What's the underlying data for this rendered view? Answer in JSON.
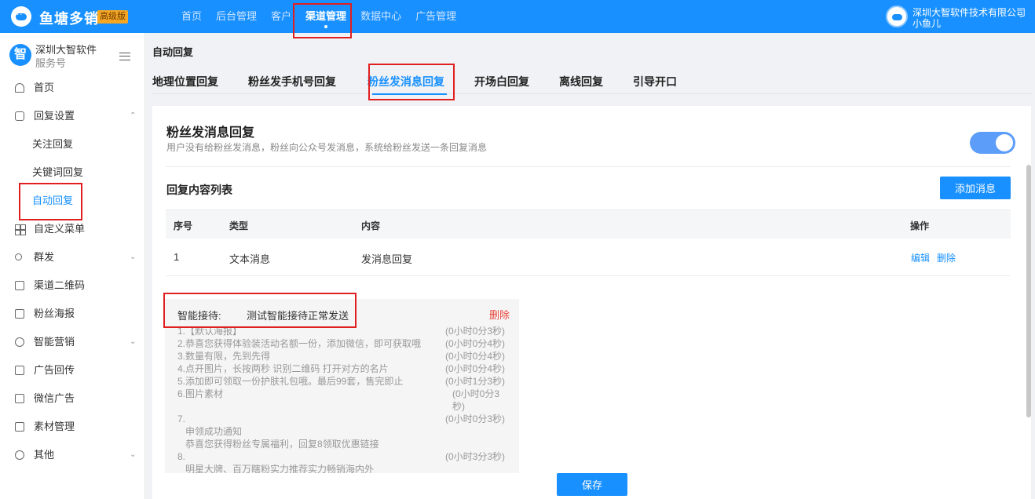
{
  "app": {
    "brand": "鱼塘多销",
    "badge": "高级版"
  },
  "topnav": {
    "items": [
      "首页",
      "后台管理",
      "客户",
      "渠道管理",
      "数据中心",
      "广告管理"
    ],
    "active": "渠道管理"
  },
  "account_top": {
    "company": "深圳大智软件技术有限公司",
    "user": "小鱼儿"
  },
  "sidebar": {
    "account": {
      "avatar_char": "智",
      "name": "深圳大智软件",
      "type": "服务号"
    },
    "items": [
      {
        "label": "首页"
      },
      {
        "label": "回复设置"
      },
      {
        "label": "关注回复"
      },
      {
        "label": "关键词回复"
      },
      {
        "label": "自动回复",
        "active": true
      },
      {
        "label": "自定义菜单"
      },
      {
        "label": "群发"
      },
      {
        "label": "渠道二维码"
      },
      {
        "label": "粉丝海报"
      },
      {
        "label": "智能营销"
      },
      {
        "label": "广告回传"
      },
      {
        "label": "微信广告"
      },
      {
        "label": "素材管理"
      },
      {
        "label": "其他"
      }
    ]
  },
  "page": {
    "title": "自动回复"
  },
  "tabs": [
    "地理位置回复",
    "粉丝发手机号回复",
    "粉丝发消息回复",
    "开场白回复",
    "离线回复",
    "引导开口"
  ],
  "panel": {
    "title": "粉丝发消息回复",
    "description": "用户没有给粉丝发消息，粉丝向公众号发消息，系统给粉丝发送一条回复消息",
    "enabled": true,
    "list_title": "回复内容列表",
    "add_button": "添加消息",
    "table": {
      "headers": [
        "序号",
        "类型",
        "内容",
        "操作"
      ],
      "rows": [
        {
          "index": "1",
          "type": "文本消息",
          "content": "发消息回复",
          "edit": "编辑",
          "delete": "删除"
        }
      ]
    },
    "smart": {
      "label": "智能接待:",
      "value": "测试智能接待正常发送",
      "delete": "删除",
      "lines": [
        "1.【默认海报】",
        "2.恭喜您获得体验装活动名额一份，添加微信，即可获取哦",
        "3.数量有限，先到先得",
        "4.点开图片，长按两秒 识别二维码 打开对方的名片",
        "5.添加即可领取一份护肤礼包哦。最后99套，售完即止",
        "6.图片素材",
        "7.",
        "申领成功通知",
        "恭喜您获得粉丝专属福利，回复8领取优惠链接",
        "8.",
        "明星大牌、百万瞎粉实力推荐实力畅销海内外"
      ],
      "times": [
        "(0小时0分3秒)",
        "(0小时0分4秒)",
        "(0小时0分4秒)",
        "(0小时0分4秒)",
        "(0小时1分3秒)",
        "(0小时0分3",
        "秒)",
        "(0小时0分3秒)",
        "(0小时3分3秒)"
      ]
    },
    "save_button": "保存"
  }
}
